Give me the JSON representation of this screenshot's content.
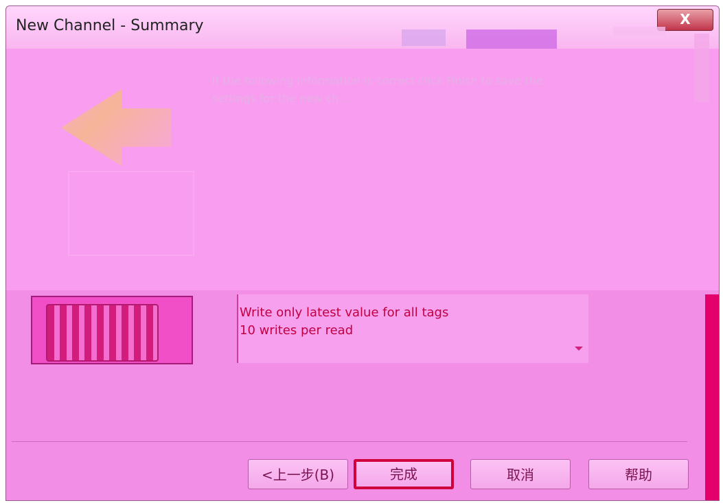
{
  "window": {
    "title": "New Channel - Summary",
    "close_label": "X"
  },
  "intro": {
    "text": "If the following information is correct click  Finish to save the settings for the new ch..."
  },
  "summary": {
    "lines": [
      "Write only latest value for all tags",
      "10 writes per read"
    ]
  },
  "buttons": {
    "back": "<上一步(B)",
    "finish": "完成",
    "cancel": "取消",
    "help": "帮助"
  },
  "icons": {
    "dropdown": "chevron-down-icon",
    "close": "close-icon",
    "wizard": "wizard-arrow-icon",
    "device": "device-icon"
  },
  "colors": {
    "background": "#f28ee6",
    "accent": "#d0003c",
    "summary_text": "#c10042"
  }
}
